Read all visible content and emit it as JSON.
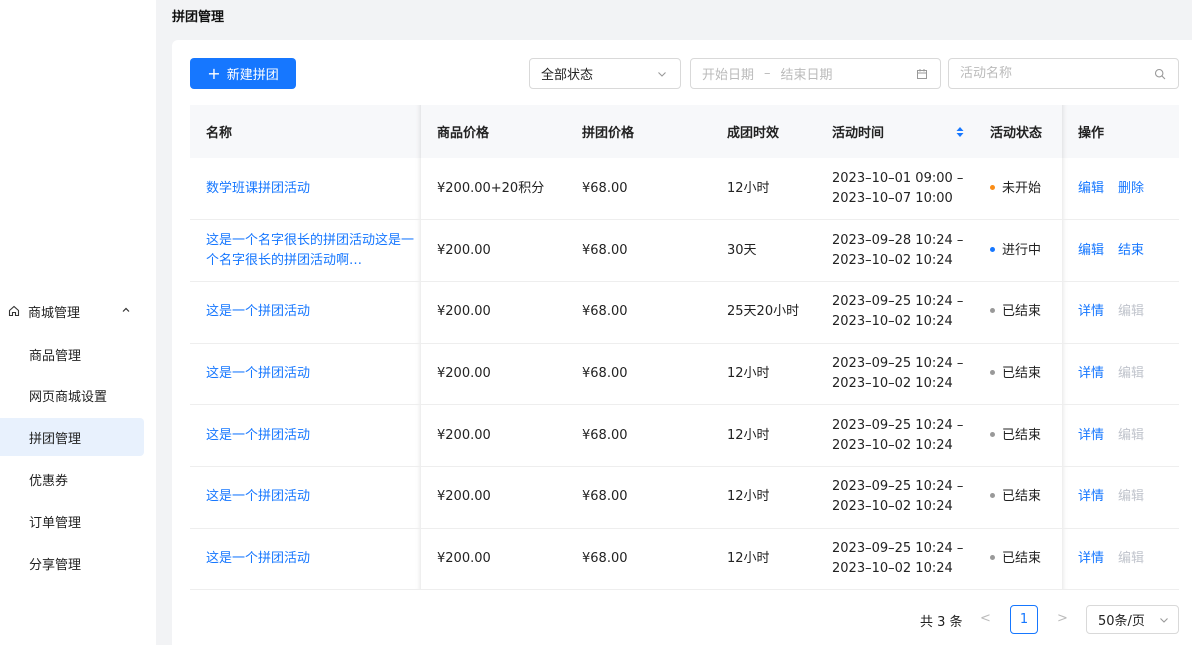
{
  "page_title": "拼团管理",
  "sidebar": {
    "group": {
      "label": "商城管理",
      "icon": "home-icon",
      "expanded": true
    },
    "items": [
      {
        "label": "商品管理",
        "active": false
      },
      {
        "label": "网页商城设置",
        "active": false
      },
      {
        "label": "拼团管理",
        "active": true
      },
      {
        "label": "优惠券",
        "active": false
      },
      {
        "label": "订单管理",
        "active": false
      },
      {
        "label": "分享管理",
        "active": false
      }
    ]
  },
  "toolbar": {
    "new_button": "新建拼团",
    "status_select": "全部状态",
    "date_start_placeholder": "开始日期",
    "date_sep": "–",
    "date_end_placeholder": "结束日期",
    "search_placeholder": "活动名称"
  },
  "table": {
    "columns": [
      "名称",
      "商品价格",
      "拼团价格",
      "成团时效",
      "活动时间",
      "活动状态",
      "操作"
    ],
    "rows": [
      {
        "name": "数学班课拼团活动",
        "price": "¥200.00+20积分",
        "group_price": "¥68.00",
        "duration": "12小时",
        "time_start": "2023–10–01 09:00 –",
        "time_end": "2023–10–07 10:00",
        "status": "未开始",
        "status_color": "#fa8c16",
        "a1": "编辑",
        "a2": "删除",
        "a2_disabled": false
      },
      {
        "name": "这是一个名字很长的拼团活动这是一个名字很长的拼团活动啊…",
        "price": "¥200.00",
        "group_price": "¥68.00",
        "duration": "30天",
        "time_start": "2023–09–28 10:24 –",
        "time_end": "2023–10–02 10:24",
        "status": "进行中",
        "status_color": "#1677ff",
        "a1": "编辑",
        "a2": "结束",
        "a2_disabled": false
      },
      {
        "name": "这是一个拼团活动",
        "price": "¥200.00",
        "group_price": "¥68.00",
        "duration": "25天20小时",
        "time_start": "2023–09–25 10:24 –",
        "time_end": "2023–10–02 10:24",
        "status": "已结束",
        "status_color": "#999999",
        "a1": "详情",
        "a2": "编辑",
        "a2_disabled": true
      },
      {
        "name": "这是一个拼团活动",
        "price": "¥200.00",
        "group_price": "¥68.00",
        "duration": "12小时",
        "time_start": "2023–09–25 10:24 –",
        "time_end": "2023–10–02 10:24",
        "status": "已结束",
        "status_color": "#999999",
        "a1": "详情",
        "a2": "编辑",
        "a2_disabled": true
      },
      {
        "name": "这是一个拼团活动",
        "price": "¥200.00",
        "group_price": "¥68.00",
        "duration": "12小时",
        "time_start": "2023–09–25 10:24 –",
        "time_end": "2023–10–02 10:24",
        "status": "已结束",
        "status_color": "#999999",
        "a1": "详情",
        "a2": "编辑",
        "a2_disabled": true
      },
      {
        "name": "这是一个拼团活动",
        "price": "¥200.00",
        "group_price": "¥68.00",
        "duration": "12小时",
        "time_start": "2023–09–25 10:24 –",
        "time_end": "2023–10–02 10:24",
        "status": "已结束",
        "status_color": "#999999",
        "a1": "详情",
        "a2": "编辑",
        "a2_disabled": true
      },
      {
        "name": "这是一个拼团活动",
        "price": "¥200.00",
        "group_price": "¥68.00",
        "duration": "12小时",
        "time_start": "2023–09–25 10:24 –",
        "time_end": "2023–10–02 10:24",
        "status": "已结束",
        "status_color": "#999999",
        "a1": "详情",
        "a2": "编辑",
        "a2_disabled": true
      }
    ]
  },
  "pagination": {
    "total_label": "共 3 条",
    "current_page": "1",
    "prev_icon": "chevron-left-icon",
    "next_icon": "chevron-right-icon",
    "page_size": "50条/页"
  },
  "colors": {
    "accent": "#1677ff",
    "not_started": "#fa8c16",
    "ended": "#999999"
  }
}
